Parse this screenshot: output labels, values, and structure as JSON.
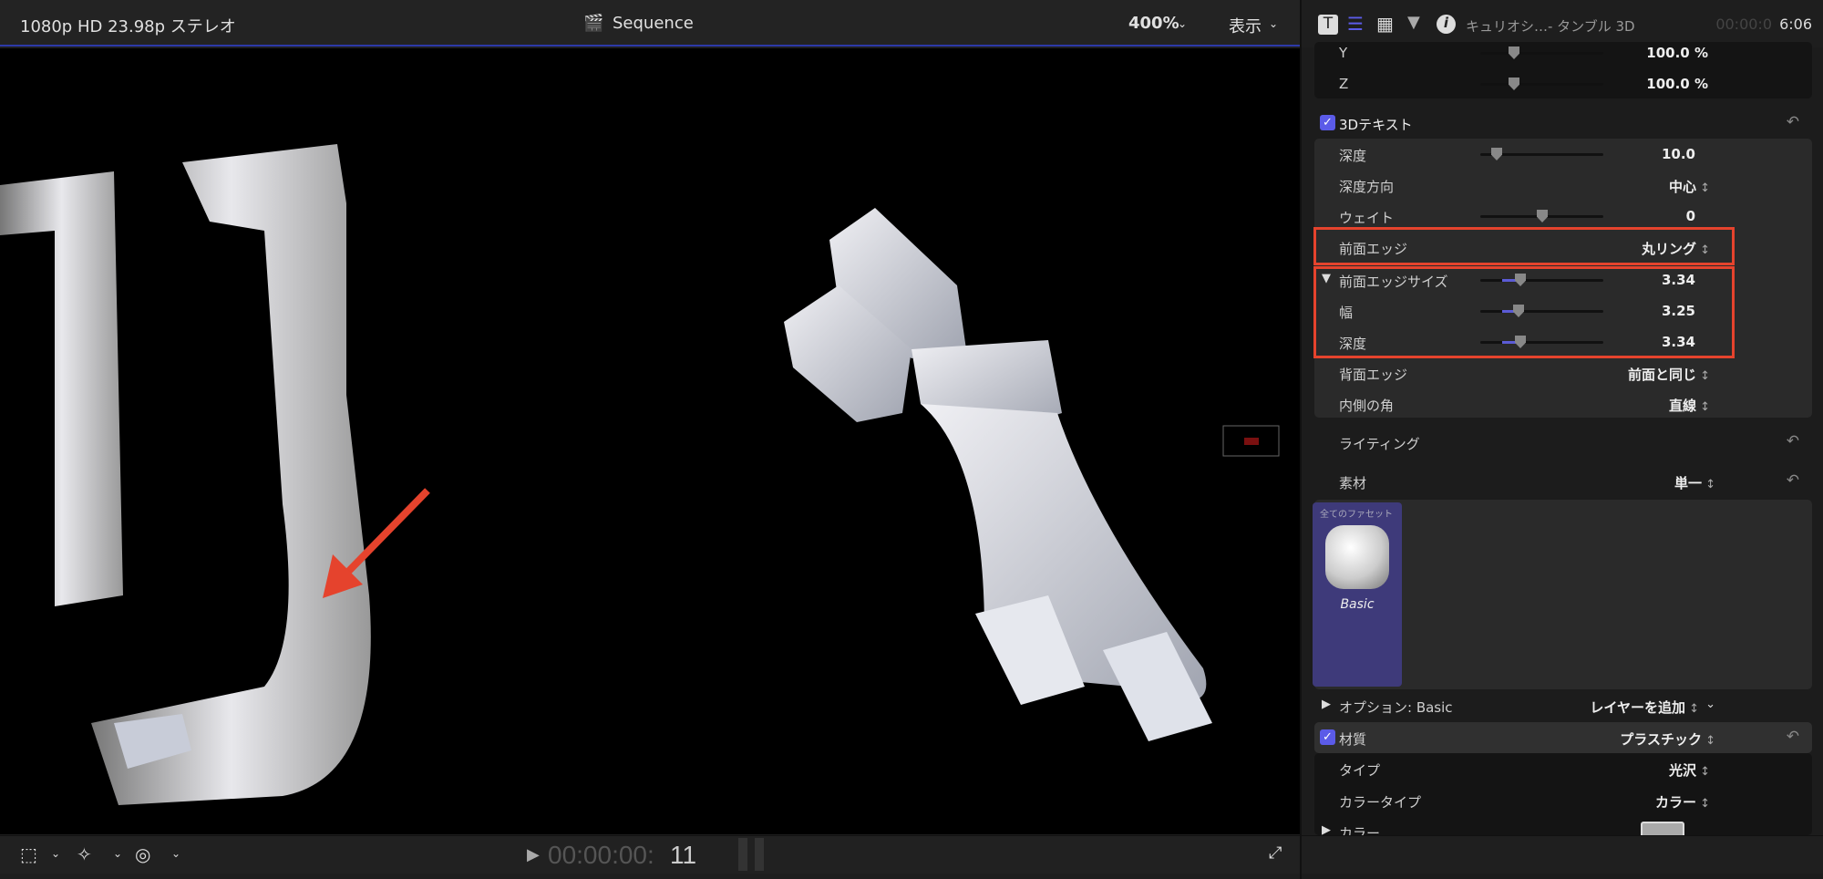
{
  "viewer": {
    "format": "1080p HD 23.98p ステレオ",
    "title": "Sequence",
    "zoom": "400%",
    "view_menu": "表示",
    "timecode_dim": "00:00:00:",
    "timecode_frame": "11"
  },
  "inspector": {
    "title": "キュリオシ…- タンブル 3D",
    "time_dim": "00:00:0",
    "time": "6:06",
    "scale_y": {
      "label": "Y",
      "value": "100.0 %"
    },
    "scale_z": {
      "label": "Z",
      "value": "100.0 %"
    },
    "section_3d": "3Dテキスト",
    "depth": {
      "label": "深度",
      "value": "10.0"
    },
    "depth_dir": {
      "label": "深度方向",
      "value": "中心"
    },
    "weight": {
      "label": "ウェイト",
      "value": "0"
    },
    "front_edge": {
      "label": "前面エッジ",
      "value": "丸リング"
    },
    "front_edge_size": {
      "label": "前面エッジサイズ",
      "value": "3.34"
    },
    "width": {
      "label": "幅",
      "value": "3.25"
    },
    "edge_depth": {
      "label": "深度",
      "value": "3.34"
    },
    "back_edge": {
      "label": "背面エッジ",
      "value": "前面と同じ"
    },
    "inner_corner": {
      "label": "内側の角",
      "value": "直線"
    },
    "lighting": "ライティング",
    "material": {
      "label": "素材",
      "value": "単一"
    },
    "facet_label": "全てのファセット",
    "material_name": "Basic",
    "options": {
      "label": "オプション: Basic",
      "add_layer": "レイヤーを追加"
    },
    "substance": {
      "label": "材質",
      "value": "プラスチック"
    },
    "type": {
      "label": "タイプ",
      "value": "光沢"
    },
    "color_type": {
      "label": "カラータイプ",
      "value": "カラー"
    },
    "color": {
      "label": "カラー"
    }
  },
  "colors": {
    "accent": "#5b5be8",
    "highlight": "#e5432d"
  }
}
